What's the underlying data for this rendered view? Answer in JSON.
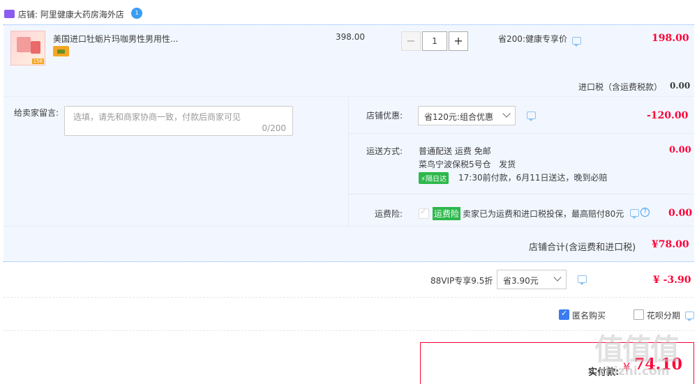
{
  "shop": {
    "prefix": "店铺: ",
    "name": "阿里健康大药房海外店",
    "badge": "1"
  },
  "item": {
    "title": "美国进口牡蛎片玛咖男性男用性...",
    "orig_price": "398.00",
    "quantity": "1",
    "discount_label": "省200:健康专享价",
    "price": "198.00",
    "thumb_badge": "158"
  },
  "tax": {
    "label": "进口税（含运费税款）",
    "value": "0.00"
  },
  "message": {
    "label": "给卖家留言:",
    "placeholder": "选填，请先和商家协商一致，付款后商家可见",
    "counter": "0/200"
  },
  "shop_discount": {
    "label": "店铺优惠:",
    "selected": "省120元:组合优惠",
    "value": "-120.00"
  },
  "shipping": {
    "label": "运送方式:",
    "method": "普通配送 运费 免邮",
    "warehouse": "菜鸟宁波保税5号仓   发货",
    "badge": "隔日达",
    "note": "17:30前付款，6月11日送达，晚到必赔",
    "value": "0.00"
  },
  "insurance": {
    "label": "运费险:",
    "tag": "运费险",
    "text": "卖家已为运费和进口税投保，最高赔付80元",
    "value": "0.00"
  },
  "subtotal": {
    "label": "店铺合计(含运费和进口税)",
    "value": "¥78.00"
  },
  "vip": {
    "label": "88VIP专享9.5折",
    "selected": "省3.90元",
    "value": "¥ -3.90"
  },
  "options": {
    "anonymous": "匿名购买",
    "huabei": "花呗分期"
  },
  "total": {
    "label": "实付款:",
    "currency": "¥",
    "value": "74.10"
  },
  "watermark": {
    "text": "值值值",
    "url": "zhizhi.com"
  }
}
